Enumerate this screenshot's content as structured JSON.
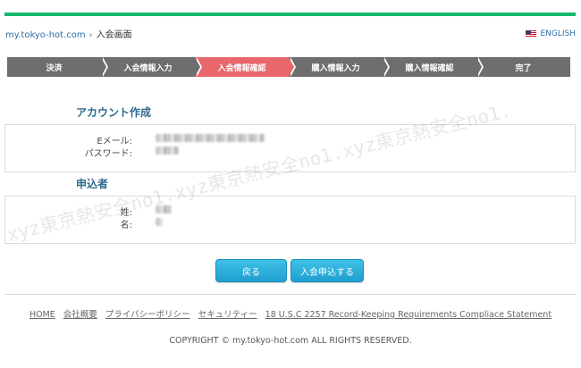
{
  "breadcrumb": {
    "site": "my.tokyo-hot.com",
    "separator": "›",
    "current": "入会画面"
  },
  "language": {
    "label": "ENGLISH",
    "icon": "us-flag-icon"
  },
  "steps": [
    {
      "label": "決済",
      "active": false
    },
    {
      "label": "入会情報入力",
      "active": false
    },
    {
      "label": "入会情報確認",
      "active": true
    },
    {
      "label": "購入情報入力",
      "active": false
    },
    {
      "label": "購入情報確認",
      "active": false
    },
    {
      "label": "完了",
      "active": false
    }
  ],
  "account": {
    "title": "アカウント作成",
    "email_label": "Eメール:",
    "password_label": "パスワード:"
  },
  "applicant": {
    "title": "申込者",
    "last_name_label": "姓:",
    "first_name_label": "名:"
  },
  "buttons": {
    "back": "戻る",
    "submit": "入会申込する"
  },
  "footer": {
    "links": [
      "HOME",
      "会社概要",
      "プライバシーポリシー",
      "セキュリティー",
      "18 U.S.C 2257 Record-Keeping Requirements Compliace Statement"
    ],
    "copyright": "COPYRIGHT © my.tokyo-hot.com ALL RIGHTS RESERVED."
  },
  "watermark": "xyz東京熱安全no1.xyz東京熱安全no1.xyz東京熱安全no1.",
  "colors": {
    "accent_green": "#16b96e",
    "active_step": "#e8676b",
    "step_bg": "#6e6e6e",
    "button": "#2aaedb",
    "title": "#2d6a8f"
  }
}
